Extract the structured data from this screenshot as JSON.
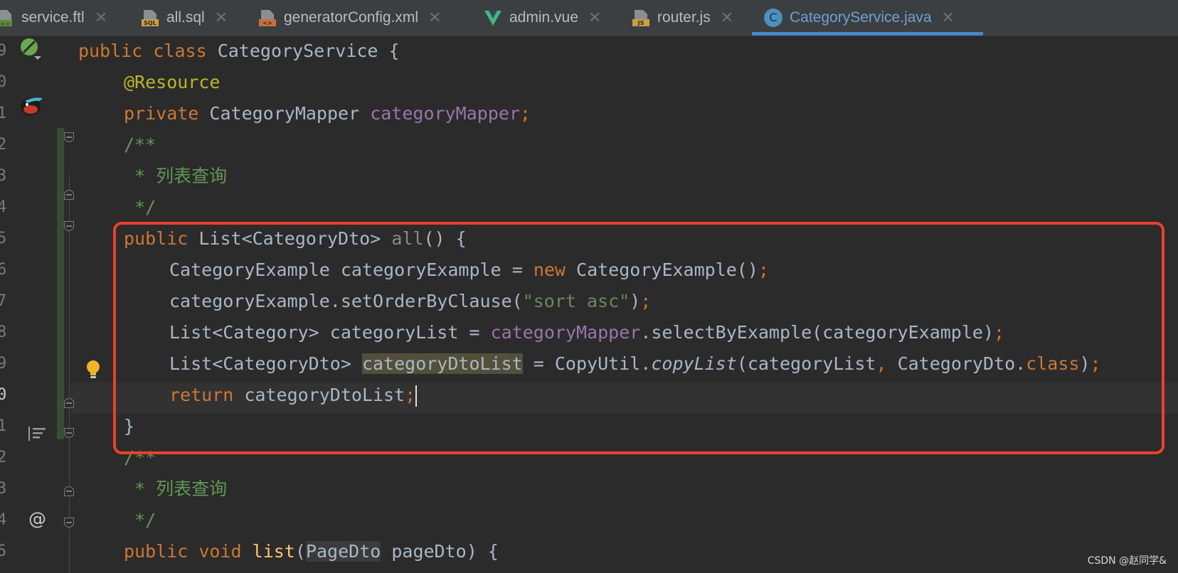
{
  "tabs": [
    {
      "label": "service.ftl",
      "icon": "ftl-file-icon",
      "active": false
    },
    {
      "label": "all.sql",
      "icon": "sql-file-icon",
      "icon_tag": "SQL",
      "active": false
    },
    {
      "label": "generatorConfig.xml",
      "icon": "xml-file-icon",
      "icon_tag": "<>",
      "active": false
    },
    {
      "label": "admin.vue",
      "icon": "vue-file-icon",
      "active": false
    },
    {
      "label": "router.js",
      "icon": "js-file-icon",
      "icon_tag": "JS",
      "active": false
    },
    {
      "label": "CategoryService.java",
      "icon": "java-class-icon",
      "icon_glyph": "C",
      "active": true
    }
  ],
  "close_glyph": "✕",
  "line_numbers": [
    "9",
    "0",
    "1",
    "2",
    "3",
    "4",
    "5",
    "6",
    "7",
    "8",
    "9",
    "0",
    "1",
    "2",
    "3",
    "4",
    "5"
  ],
  "code": {
    "l0": {
      "kw1": "public",
      "kw2": "class",
      "name": "CategoryService",
      "brace": "{"
    },
    "l1": {
      "annotation": "@Resource"
    },
    "l2": {
      "kw": "private",
      "type": "CategoryMapper",
      "field": "categoryMapper",
      "semi": ";"
    },
    "l3": {
      "text": "/**"
    },
    "l4": {
      "text": " * 列表查询"
    },
    "l5": {
      "text": " */"
    },
    "l6": {
      "kw": "public",
      "type": "List<CategoryDto>",
      "method": "all",
      "rest": "() {"
    },
    "l7": {
      "type": "CategoryExample",
      "var": "categoryExample",
      "eq": "=",
      "kw": "new",
      "call": "CategoryExample()",
      "semi": ";"
    },
    "l8": {
      "call": "categoryExample.setOrderByClause(",
      "str": "\"sort asc\"",
      "close": ")",
      "semi": ";"
    },
    "l9": {
      "type": "List<Category>",
      "var": "categoryList",
      "eq": "=",
      "field": "categoryMapper",
      "call": ".selectByExample(categoryExample)",
      "semi": ";"
    },
    "l10": {
      "type": "List<CategoryDto>",
      "var": "categoryDtoList",
      "eq": "= CopyUtil.",
      "method": "copyList",
      "args1": "(categoryList",
      "comma": ",",
      "args2": " CategoryDto.",
      "kw": "class",
      "close": ")",
      "semi": ";"
    },
    "l11": {
      "kw": "return",
      "var": "categoryDtoList",
      "semi": ";"
    },
    "l12": {
      "text": "}"
    },
    "l13": {
      "text": "/**"
    },
    "l14": {
      "text": " * 列表查询"
    },
    "l15": {
      "text": " */"
    },
    "l16": {
      "kw1": "public",
      "kw2": "void",
      "method": "list",
      "paren": "(",
      "type": "PageDto",
      "rest": " pageDto) {"
    }
  },
  "gutter": {
    "at_glyph": "@"
  },
  "watermark": "CSDN @赵同学&"
}
